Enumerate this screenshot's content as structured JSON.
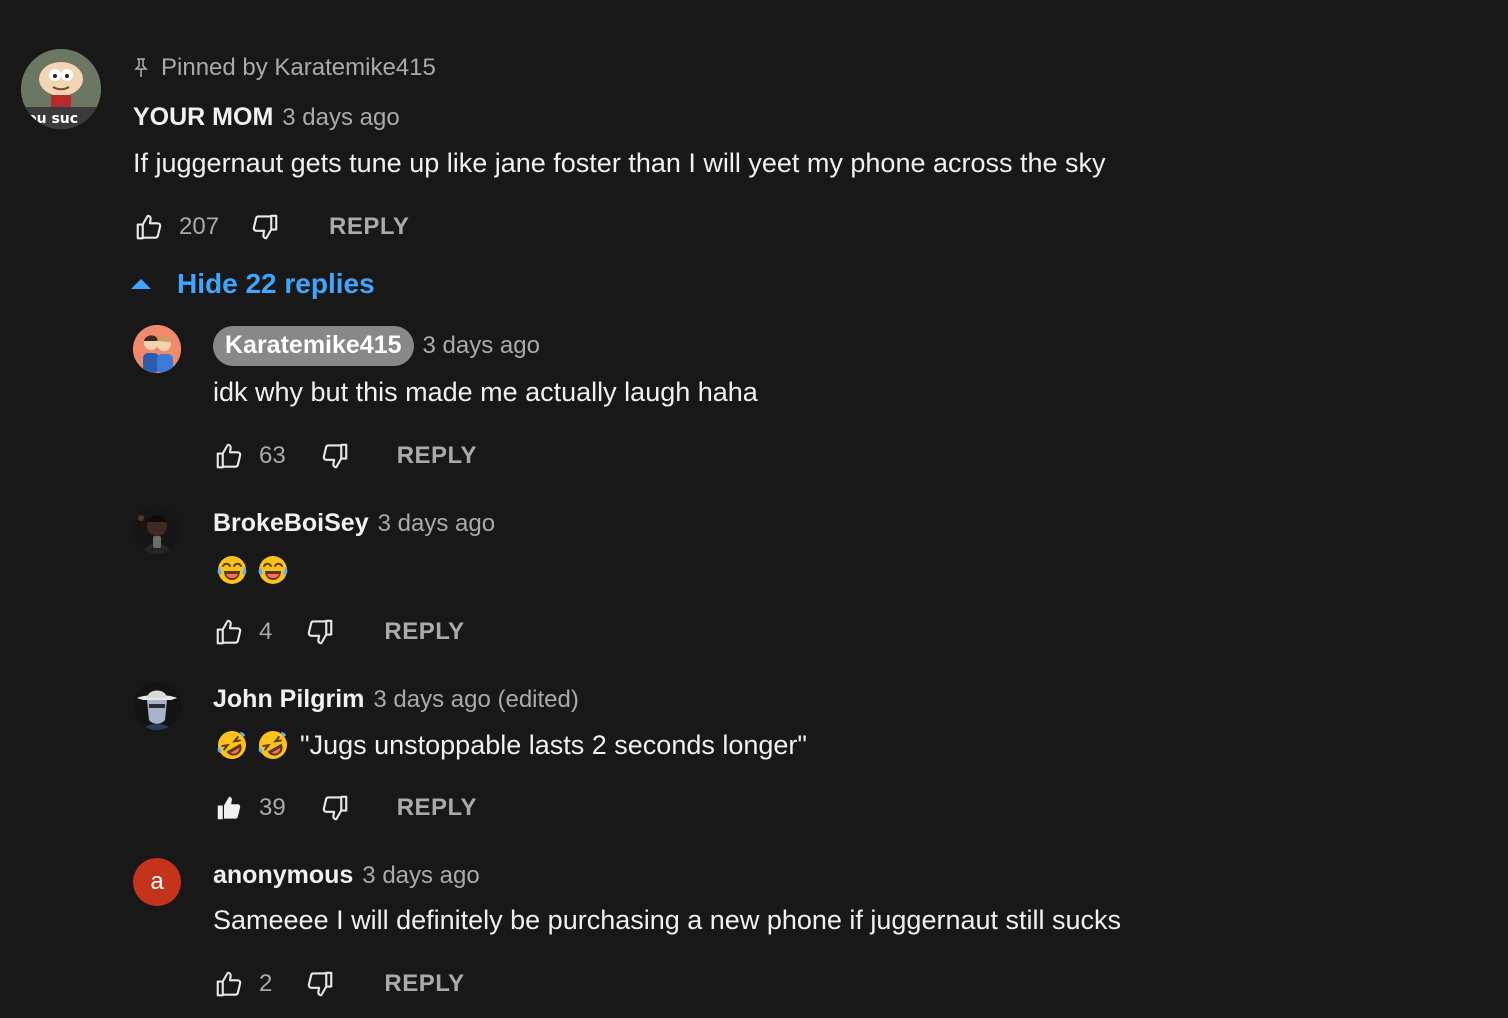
{
  "pinned": {
    "label": "Pinned by Karatemike415"
  },
  "top_comment": {
    "author": "YOUR MOM",
    "time": "3 days ago",
    "text": "If juggernaut gets tune up like jane foster than I will yeet my phone across the sky",
    "likes": "207",
    "reply_label": "REPLY",
    "avatar_icon": "cartoon-avatar-icon",
    "avatar_text": "ou suc"
  },
  "replies_toggle": {
    "label": "Hide 22 replies",
    "color": "#3ea6ff"
  },
  "replies": [
    {
      "author": "Karatemike415",
      "time": "3 days ago",
      "text": "idk why but this made me actually laugh haha",
      "likes": "63",
      "reply_label": "REPLY",
      "is_channel_owner": true,
      "liked": false
    },
    {
      "author": "BrokeBoiSey",
      "time": "3 days ago",
      "emojis": [
        "face-with-tears-of-joy",
        "face-with-tears-of-joy"
      ],
      "likes": "4",
      "reply_label": "REPLY",
      "liked": false
    },
    {
      "author": "John Pilgrim",
      "time": "3 days ago (edited)",
      "emojis": [
        "rolling-on-the-floor-laughing",
        "rolling-on-the-floor-laughing"
      ],
      "text": "\"Jugs unstoppable lasts 2 seconds longer\"",
      "likes": "39",
      "reply_label": "REPLY",
      "liked": true
    },
    {
      "author": "anonymous",
      "time": "3 days ago",
      "text": "Sameeee I will definitely be purchasing a new phone if juggernaut still sucks",
      "likes": "2",
      "reply_label": "REPLY",
      "avatar_letter": "a",
      "avatar_color": "#c4331a",
      "liked": false
    }
  ],
  "colors": {
    "background": "#181818",
    "primary_text": "#f1f1f1",
    "secondary_text": "#aaaaaa",
    "link": "#3ea6ff",
    "owner_chip": "#888888"
  }
}
